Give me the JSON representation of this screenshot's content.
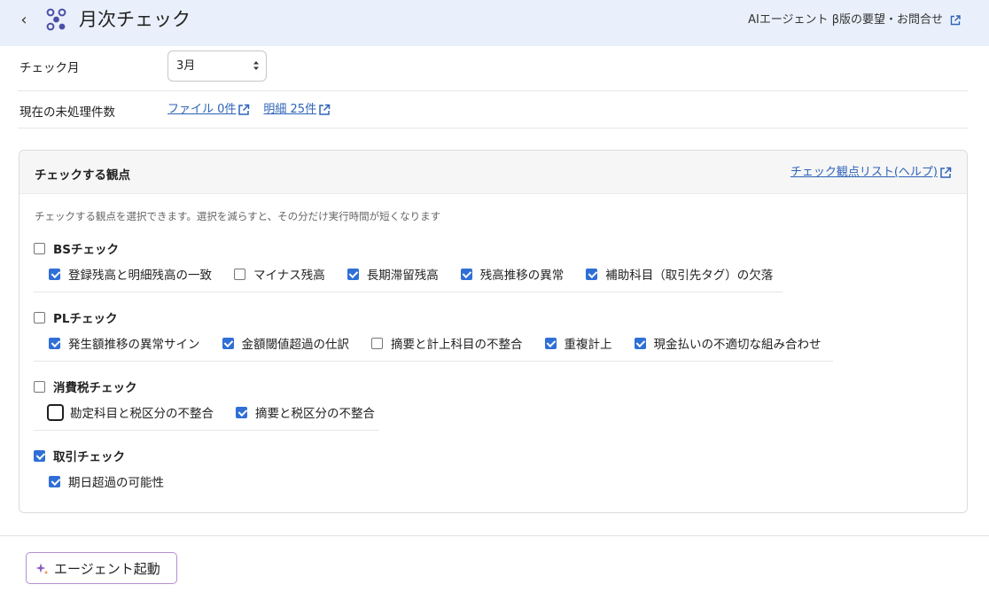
{
  "header": {
    "title": "月次チェック",
    "feedback_link": "AIエージェント β版の要望・お問合せ"
  },
  "month_row": {
    "label": "チェック月",
    "selected": "3月"
  },
  "pending_row": {
    "label": "現在の未処理件数",
    "files_link": "ファイル 0件",
    "details_link": "明細 25件"
  },
  "card": {
    "title": "チェックする観点",
    "help_link": "チェック観点リスト(ヘルプ)",
    "description": "チェックする観点を選択できます。選択を減らすと、その分だけ実行時間が短くなります",
    "groups": [
      {
        "label": "BSチェック",
        "checked": false,
        "items": [
          {
            "label": "登録残高と明細残高の一致",
            "checked": true
          },
          {
            "label": "マイナス残高",
            "checked": false
          },
          {
            "label": "長期滞留残高",
            "checked": true
          },
          {
            "label": "残高推移の異常",
            "checked": true
          },
          {
            "label": "補助科目（取引先タグ）の欠落",
            "checked": true
          }
        ]
      },
      {
        "label": "PLチェック",
        "checked": false,
        "items": [
          {
            "label": "発生額推移の異常サイン",
            "checked": true
          },
          {
            "label": "金額閾値超過の仕訳",
            "checked": true
          },
          {
            "label": "摘要と計上科目の不整合",
            "checked": false
          },
          {
            "label": "重複計上",
            "checked": true
          },
          {
            "label": "現金払いの不適切な組み合わせ",
            "checked": true
          }
        ]
      },
      {
        "label": "消費税チェック",
        "checked": false,
        "items": [
          {
            "label": "勘定科目と税区分の不整合",
            "checked": false,
            "focused": true
          },
          {
            "label": "摘要と税区分の不整合",
            "checked": true
          }
        ]
      },
      {
        "label": "取引チェック",
        "checked": true,
        "items": [
          {
            "label": "期日超過の可能性",
            "checked": true
          }
        ]
      }
    ]
  },
  "footer": {
    "agent_button": "エージェント起動"
  },
  "colors": {
    "header_bg": "#eaf0fb",
    "link": "#2e63b8",
    "checkbox": "#2f6fd6",
    "agent_border": "#b58ecf"
  }
}
